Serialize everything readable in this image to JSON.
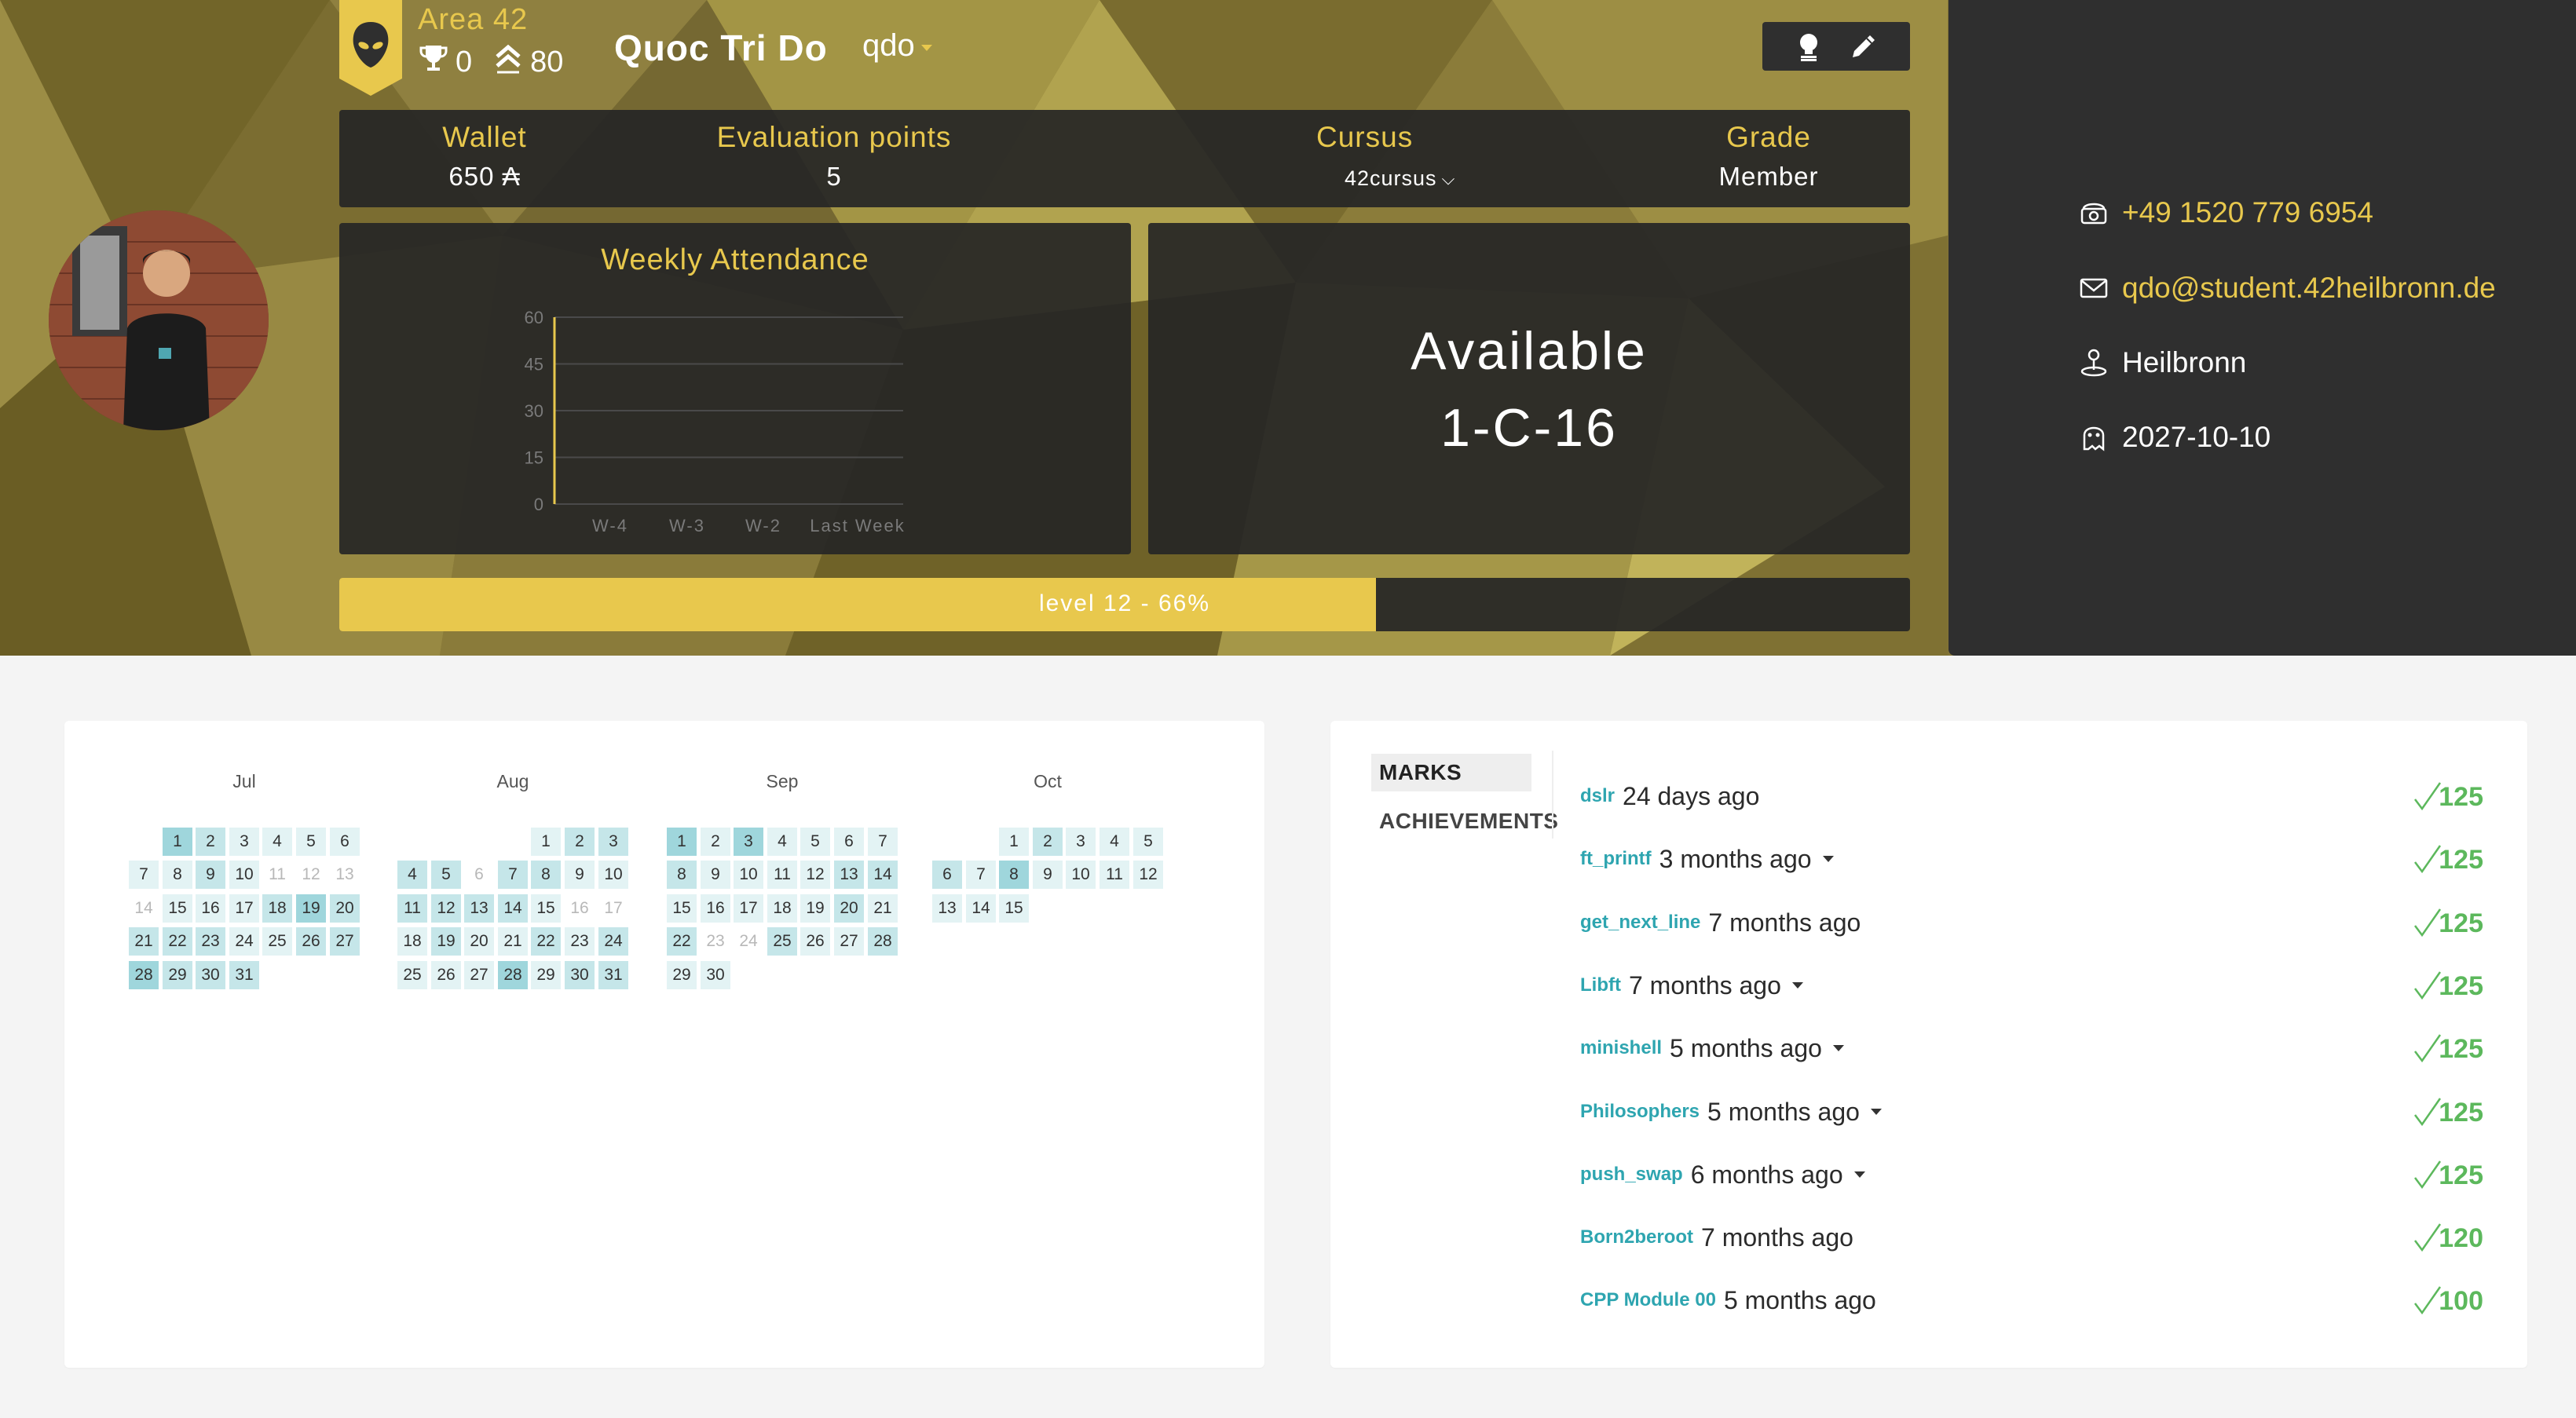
{
  "colors": {
    "accent_gold": "#e8c84d",
    "dark_panel": "#262626",
    "teal_link": "#2ea5b0",
    "success_green": "#5cb85c",
    "cal_dark": "#9fd6dc",
    "cal_mid": "#c5e6e9",
    "cal_light": "#e3f3f4"
  },
  "header": {
    "coalition_name": "Area 42",
    "coalition_icon": "alien-head-icon",
    "trophy_count": "0",
    "rank_score": "80",
    "full_name": "Quoc Tri Do",
    "login": "qdo",
    "actions": [
      "lightbulb-icon",
      "pencil-icon"
    ]
  },
  "stats": {
    "wallet_label": "Wallet",
    "wallet_value": "650 ₳",
    "eval_label": "Evaluation points",
    "eval_value": "5",
    "cursus_label": "Cursus",
    "cursus_value": "42cursus",
    "grade_label": "Grade",
    "grade_value": "Member"
  },
  "attendance": {
    "title": "Weekly Attendance",
    "chart_data": {
      "type": "line",
      "title": "Weekly Attendance",
      "categories": [
        "W-4",
        "W-3",
        "W-2",
        "Last Week"
      ],
      "series": [
        {
          "values": [
            0,
            0,
            0,
            0
          ]
        }
      ],
      "y_ticks": [
        0,
        15,
        30,
        45,
        60
      ],
      "ylim": [
        0,
        60
      ],
      "grid": true
    }
  },
  "location": {
    "status": "Available",
    "host": "1-C-16"
  },
  "level": {
    "label": "level 12 - 66%",
    "progress": 0.66
  },
  "contact": {
    "phone": "+49 1520 779 6954",
    "email": "qdo@student.42heilbronn.de",
    "city": "Heilbronn",
    "date": "2027-10-10"
  },
  "calendar": {
    "months": [
      {
        "name": "Jul",
        "weeks": [
          [
            null,
            1,
            2,
            3,
            4,
            5,
            6
          ],
          [
            7,
            8,
            9,
            10,
            11,
            12,
            13
          ],
          [
            14,
            15,
            16,
            17,
            18,
            19,
            20
          ],
          [
            21,
            22,
            23,
            24,
            25,
            26,
            27
          ],
          [
            28,
            29,
            30,
            31,
            null,
            null,
            null
          ]
        ],
        "levels": [
          [
            null,
            3,
            2,
            1,
            1,
            1,
            1
          ],
          [
            1,
            1,
            2,
            1,
            0,
            0,
            0
          ],
          [
            0,
            1,
            1,
            1,
            2,
            3,
            2
          ],
          [
            2,
            2,
            2,
            1,
            1,
            2,
            2
          ],
          [
            3,
            2,
            2,
            2,
            null,
            null,
            null
          ]
        ]
      },
      {
        "name": "Aug",
        "weeks": [
          [
            null,
            null,
            null,
            null,
            1,
            2,
            3
          ],
          [
            4,
            5,
            6,
            7,
            8,
            9,
            10
          ],
          [
            11,
            12,
            13,
            14,
            15,
            16,
            17
          ],
          [
            18,
            19,
            20,
            21,
            22,
            23,
            24
          ],
          [
            25,
            26,
            27,
            28,
            29,
            30,
            31
          ]
        ],
        "levels": [
          [
            null,
            null,
            null,
            null,
            1,
            2,
            2
          ],
          [
            2,
            2,
            0,
            2,
            2,
            1,
            1
          ],
          [
            2,
            2,
            2,
            2,
            1,
            0,
            0
          ],
          [
            1,
            2,
            1,
            1,
            2,
            1,
            2
          ],
          [
            1,
            1,
            1,
            3,
            1,
            2,
            2
          ]
        ]
      },
      {
        "name": "Sep",
        "weeks": [
          [
            1,
            2,
            3,
            4,
            5,
            6,
            7
          ],
          [
            8,
            9,
            10,
            11,
            12,
            13,
            14
          ],
          [
            15,
            16,
            17,
            18,
            19,
            20,
            21
          ],
          [
            22,
            23,
            24,
            25,
            26,
            27,
            28
          ],
          [
            29,
            30,
            null,
            null,
            null,
            null,
            null
          ]
        ],
        "levels": [
          [
            3,
            1,
            3,
            1,
            1,
            1,
            1
          ],
          [
            2,
            1,
            1,
            1,
            1,
            2,
            2
          ],
          [
            1,
            1,
            1,
            1,
            1,
            2,
            1
          ],
          [
            2,
            0,
            0,
            2,
            1,
            1,
            2
          ],
          [
            1,
            1,
            null,
            null,
            null,
            null,
            null
          ]
        ]
      },
      {
        "name": "Oct",
        "weeks": [
          [
            null,
            null,
            1,
            2,
            3,
            4,
            5
          ],
          [
            6,
            7,
            8,
            9,
            10,
            11,
            12
          ],
          [
            13,
            14,
            15,
            null,
            null,
            null,
            null
          ]
        ],
        "levels": [
          [
            null,
            null,
            1,
            2,
            1,
            1,
            1
          ],
          [
            2,
            1,
            3,
            1,
            1,
            1,
            1
          ],
          [
            1,
            1,
            1,
            null,
            null,
            null,
            null
          ]
        ]
      }
    ]
  },
  "marks": {
    "tabs": [
      "MARKS",
      "ACHIEVEMENTS"
    ],
    "items": [
      {
        "project": "dslr",
        "time": "24 days ago",
        "score": "125",
        "dropdown": false
      },
      {
        "project": "ft_printf",
        "time": "3 months ago",
        "score": "125",
        "dropdown": true
      },
      {
        "project": "get_next_line",
        "time": "7 months ago",
        "score": "125",
        "dropdown": false
      },
      {
        "project": "Libft",
        "time": "7 months ago",
        "score": "125",
        "dropdown": true
      },
      {
        "project": "minishell",
        "time": "5 months ago",
        "score": "125",
        "dropdown": true
      },
      {
        "project": "Philosophers",
        "time": "5 months ago",
        "score": "125",
        "dropdown": true
      },
      {
        "project": "push_swap",
        "time": "6 months ago",
        "score": "125",
        "dropdown": true
      },
      {
        "project": "Born2beroot",
        "time": "7 months ago",
        "score": "120",
        "dropdown": false
      },
      {
        "project": "CPP Module 00",
        "time": "5 months ago",
        "score": "100",
        "dropdown": false
      }
    ]
  }
}
